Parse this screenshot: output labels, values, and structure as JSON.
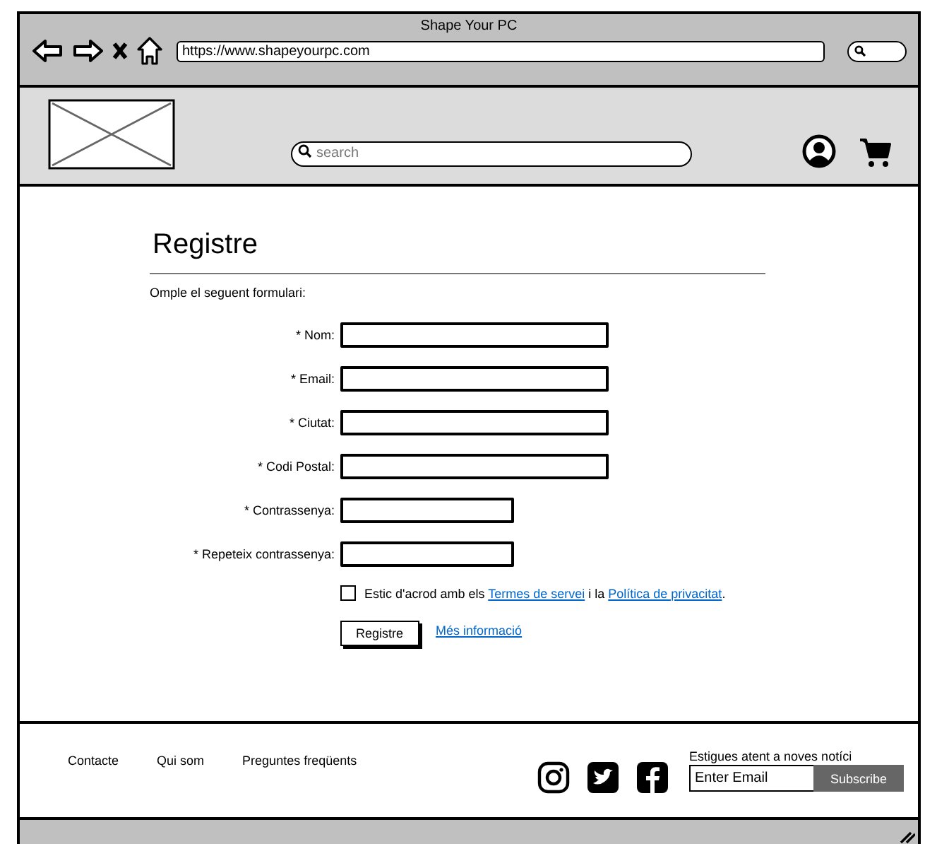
{
  "browser": {
    "title": "Shape Your PC",
    "url": "https://www.shapeyourpc.com"
  },
  "header": {
    "search": {
      "placeholder": "search"
    }
  },
  "form": {
    "title": "Registre",
    "intro": "Omple el seguent formulari:",
    "fields": [
      {
        "label": "* Nom:",
        "kind": "wide"
      },
      {
        "label": "* Email:",
        "kind": "wide"
      },
      {
        "label": "* Ciutat:",
        "kind": "wide"
      },
      {
        "label": "* Codi Postal:",
        "kind": "wide"
      },
      {
        "label": "* Contrassenya:",
        "kind": "narrow"
      },
      {
        "label": "* Repeteix contrassenya:",
        "kind": "narrow"
      }
    ],
    "agreement": {
      "checked": false,
      "parts": [
        {
          "kind": "text",
          "text": "Estic d'acrod amb els "
        },
        {
          "kind": "link",
          "text": "Termes de servei"
        },
        {
          "kind": "text",
          "text": " i la "
        },
        {
          "kind": "link",
          "text": "Política de privacitat"
        },
        {
          "kind": "text",
          "text": "."
        }
      ]
    },
    "submit": "Registre",
    "more_link": "Més informació"
  },
  "footer": {
    "links": [
      "Contacte",
      "Qui som",
      "Preguntes freqüents"
    ],
    "newsletter": {
      "title": "Estigues atent a noves notíci",
      "placeholder": "Enter Email",
      "button": "Subscribe"
    }
  }
}
